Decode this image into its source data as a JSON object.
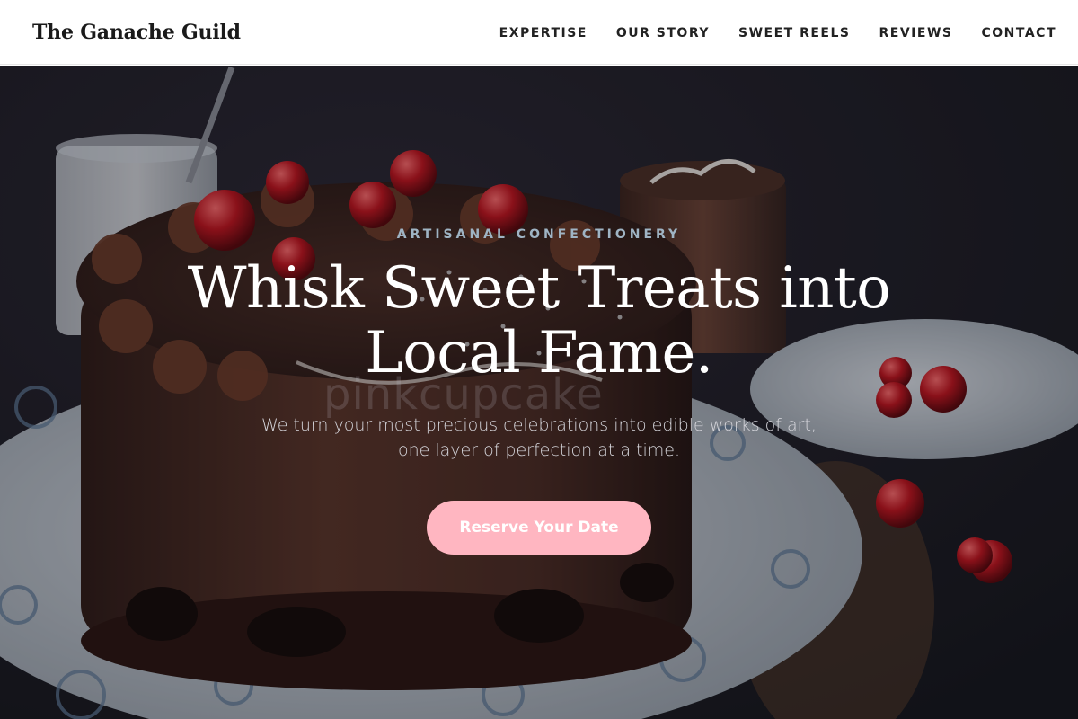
{
  "header": {
    "brand": "The Ganache Guild",
    "nav": [
      {
        "label": "EXPERTISE"
      },
      {
        "label": "OUR STORY"
      },
      {
        "label": "SWEET REELS"
      },
      {
        "label": "REVIEWS"
      },
      {
        "label": "CONTACT"
      }
    ]
  },
  "hero": {
    "eyebrow": "ARTISANAL CONFECTIONERY",
    "headline_line1": "Whisk Sweet Treats into",
    "headline_line2": "Local Fame.",
    "subtitle_line1": "We turn your most precious celebrations into edible works of art,",
    "subtitle_line2": "one layer of perfection at a time.",
    "cta_label": "Reserve Your Date",
    "watermark": "pinkcupcake"
  },
  "colors": {
    "accent_button": "#ffb6c1",
    "eyebrow": "#9fb4c4",
    "nav_text": "#222222"
  }
}
